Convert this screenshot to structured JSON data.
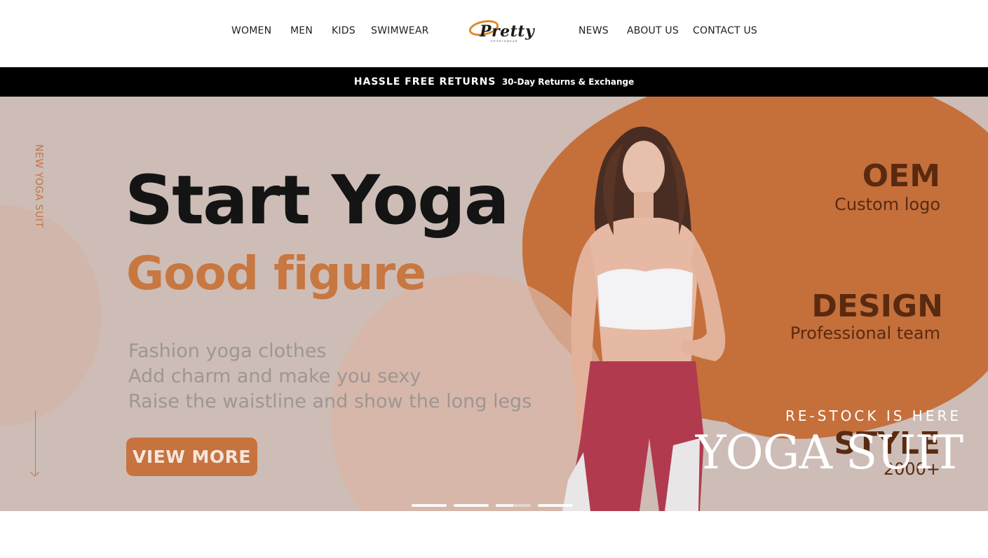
{
  "header": {
    "nav_left": [
      "WOMEN",
      "MEN",
      "KIDS",
      "SWIMWEAR"
    ],
    "nav_right": [
      "NEWS",
      "ABOUT US",
      "CONTACT US"
    ],
    "logo_text": "Pretty",
    "logo_sub": "SPORTSWEAR"
  },
  "promo": {
    "strong": "HASSLE FREE RETURNS",
    "small": "30-Day Returns & Exchange"
  },
  "hero": {
    "side_label": "NEW YOGA SUIT",
    "headline": "Start Yoga",
    "subheadline": "Good figure",
    "description": [
      "Fashion yoga clothes",
      "Add charm and make you sexy",
      "Raise the waistline and show the long legs"
    ],
    "button_label": "VIEW MORE",
    "features": [
      {
        "title": "OEM",
        "subtitle": "Custom logo"
      },
      {
        "title": "DESIGN",
        "subtitle": "Professional team"
      },
      {
        "title": "STYLE",
        "subtitle": "2000+"
      }
    ],
    "restock": "RE-STOCK IS HERE",
    "overlay_title": "YOGA SUIT",
    "slides_total": 4,
    "active_slide": 3,
    "active_slide_progress": 0.5
  },
  "colors": {
    "accent": "#c7733f",
    "hero_bg": "#cdbdb6",
    "promo_bg": "#000000",
    "dark_text": "#141414"
  }
}
